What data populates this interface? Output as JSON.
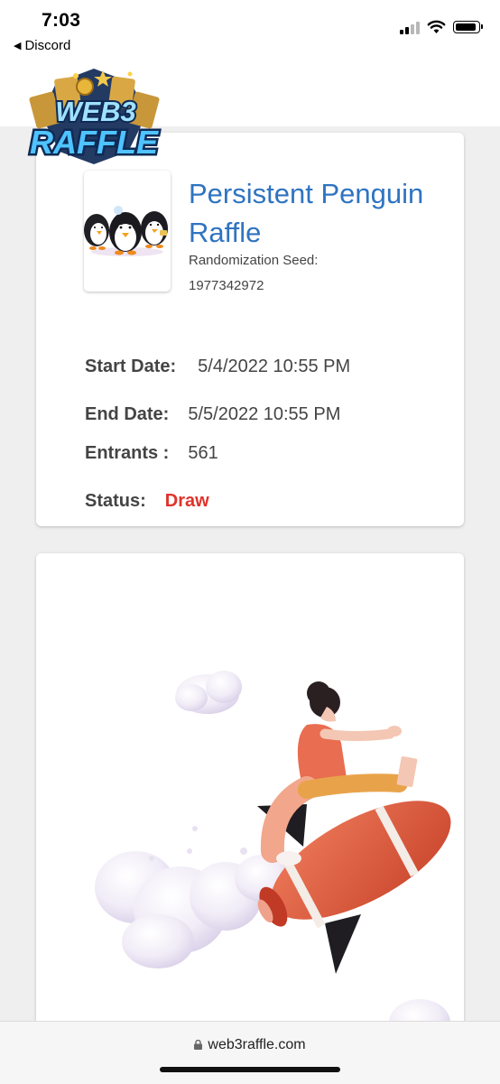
{
  "status_bar": {
    "time": "7:03",
    "back_label": "Discord",
    "battery_level": 0.85
  },
  "logo": {
    "line1": "WEB3",
    "line2": "RAFFLE"
  },
  "raffle": {
    "title": "Persistent Penguin Raffle",
    "seed_label": "Randomization Seed:",
    "seed_value": "1977342972",
    "start_label": "Start Date:",
    "start_value": "5/4/2022 10:55 PM",
    "end_label": "End Date:",
    "end_value": "5/5/2022 10:55 PM",
    "entrants_label": "Entrants :",
    "entrants_value": "561",
    "status_label": "Status:",
    "status_value": "Draw",
    "status_color": "#e0332b"
  },
  "browser": {
    "url": "web3raffle.com"
  },
  "icons": {
    "back": "back-triangle-icon",
    "signal": "cellular-signal-icon",
    "wifi": "wifi-icon",
    "battery": "battery-icon",
    "lock": "lock-icon"
  }
}
